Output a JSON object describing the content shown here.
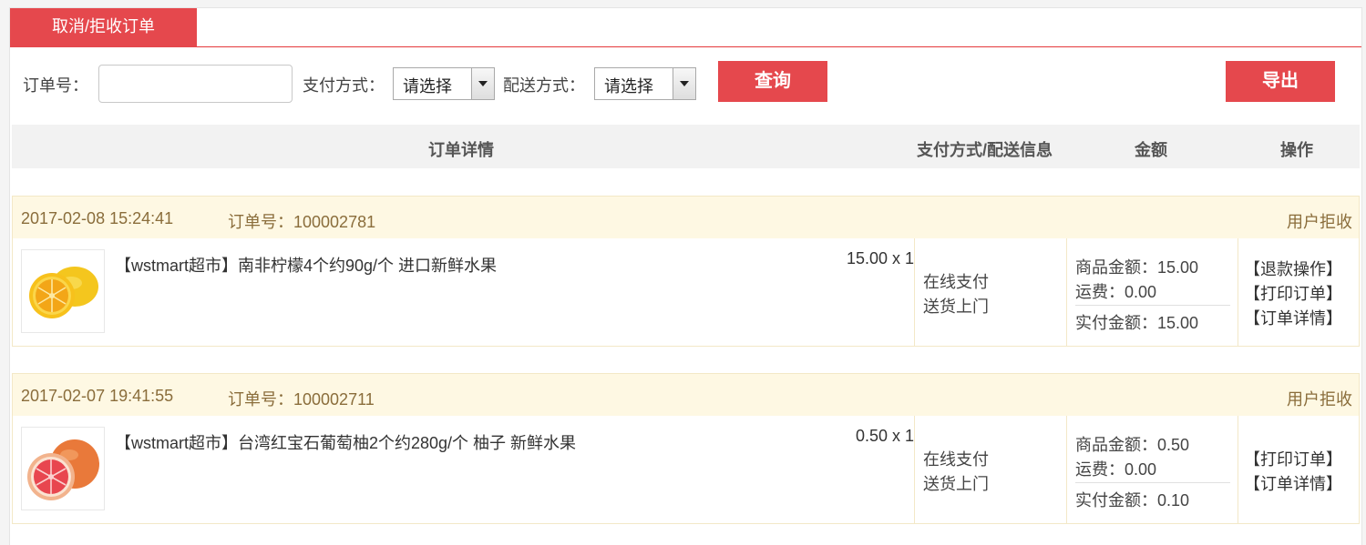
{
  "tab": {
    "label": "取消/拒收订单"
  },
  "filters": {
    "order_no_label": "订单号：",
    "order_no_value": "",
    "payment_label": "支付方式：",
    "payment_selected": "请选择",
    "delivery_label": "配送方式：",
    "delivery_selected": "请选择",
    "query_button": "查询",
    "export_button": "导出"
  },
  "table_header": {
    "details": "订单详情",
    "payment_delivery": "支付方式/配送信息",
    "amount": "金额",
    "actions": "操作"
  },
  "orders": [
    {
      "date": "2017-02-08 15:24:41",
      "order_no_label": "订单号：",
      "order_no": "100002781",
      "status": "用户拒收",
      "product_name": "【wstmart超市】南非柠檬4个约90g/个 进口新鲜水果",
      "price_qty": "15.00 x 1",
      "payment": "在线支付",
      "delivery": "送货上门",
      "goods_amount_label": "商品金额：",
      "goods_amount": "15.00",
      "shipping_label": "运费：",
      "shipping": "0.00",
      "paid_label": "实付金额：",
      "paid": "15.00",
      "actions": [
        "【退款操作】",
        "【打印订单】",
        "【订单详情】"
      ]
    },
    {
      "date": "2017-02-07 19:41:55",
      "order_no_label": "订单号：",
      "order_no": "100002711",
      "status": "用户拒收",
      "product_name": "【wstmart超市】台湾红宝石葡萄柚2个约280g/个 柚子 新鲜水果",
      "price_qty": "0.50 x 1",
      "payment": "在线支付",
      "delivery": "送货上门",
      "goods_amount_label": "商品金额：",
      "goods_amount": "0.50",
      "shipping_label": "运费：",
      "shipping": "0.00",
      "paid_label": "实付金额：",
      "paid": "0.10",
      "actions": [
        "【打印订单】",
        "【订单详情】"
      ]
    }
  ],
  "icons": {
    "lemon": "lemon-image-icon",
    "grapefruit": "grapefruit-image-icon",
    "dropdown": "chevron-down-icon"
  },
  "colors": {
    "accent": "#e5484d",
    "order_header_bg": "#fef8e3",
    "order_header_text": "#8a6d3b"
  }
}
